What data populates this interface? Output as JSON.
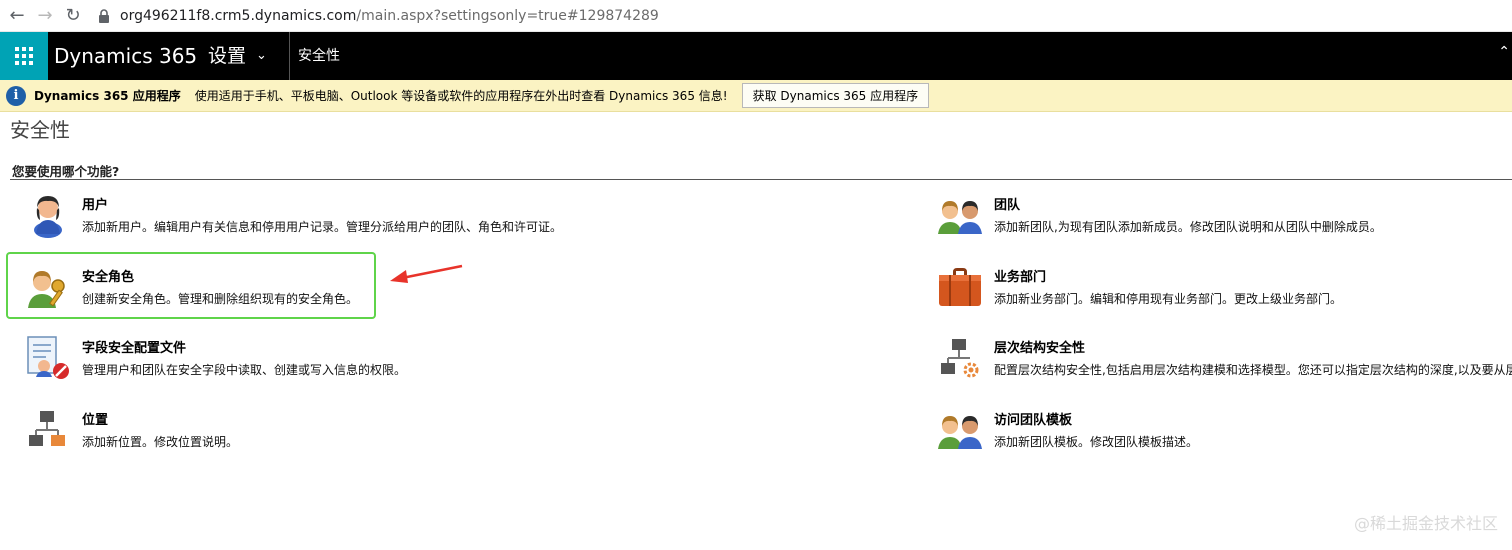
{
  "browser": {
    "url_host": "org496211f8.crm5.dynamics.com",
    "url_path": "/main.aspx?settingsonly=true#129874289"
  },
  "topbar": {
    "brand": "Dynamics 365",
    "settings_label": "设置",
    "breadcrumb": "安全性"
  },
  "notification": {
    "title": "Dynamics 365 应用程序",
    "text": "使用适用于手机、平板电脑、Outlook 等设备或软件的应用程序在外出时查看 Dynamics 365 信息!",
    "button_label": "获取 Dynamics 365 应用程序"
  },
  "page": {
    "title": "安全性",
    "question": "您要使用哪个功能?"
  },
  "items": {
    "users": {
      "title": "用户",
      "desc": "添加新用户。编辑用户有关信息和停用用户记录。管理分派给用户的团队、角色和许可证。"
    },
    "security_roles": {
      "title": "安全角色",
      "desc": "创建新安全角色。管理和删除组织现有的安全角色。"
    },
    "field_security": {
      "title": "字段安全配置文件",
      "desc": "管理用户和团队在安全字段中读取、创建或写入信息的权限。"
    },
    "positions": {
      "title": "位置",
      "desc": "添加新位置。修改位置说明。"
    },
    "teams": {
      "title": "团队",
      "desc": "添加新团队,为现有团队添加新成员。修改团队说明和从团队中删除成员。"
    },
    "business_units": {
      "title": "业务部门",
      "desc": "添加新业务部门。编辑和停用现有业务部门。更改上级业务部门。"
    },
    "hierarchy_security": {
      "title": "层次结构安全性",
      "desc": "配置层次结构安全性,包括启用层次结构建模和选择模型。您还可以指定层次结构的深度,以及要从层"
    },
    "access_team_templates": {
      "title": "访问团队模板",
      "desc": "添加新团队模板。修改团队模板描述。"
    }
  },
  "watermark": "@稀土掘金技术社区",
  "colors": {
    "waffle_bg": "#00a3b5",
    "topbar_bg": "#000000",
    "notification_bg": "#fbf3c3",
    "highlight_border": "#5fd44a",
    "annotation_arrow": "#e8332a"
  }
}
